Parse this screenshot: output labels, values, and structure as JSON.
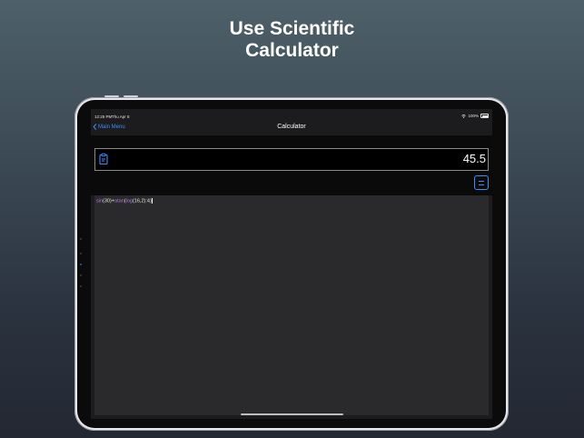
{
  "headline": {
    "line1": "Use Scientific",
    "line2": "Calculator"
  },
  "status_bar": {
    "time": "12:25 PM",
    "date": "Thu Apr 8",
    "battery": "100%"
  },
  "nav": {
    "back_label": "Main Menu",
    "title": "Calculator"
  },
  "result": {
    "value": "45.5"
  },
  "expression": {
    "parts": [
      {
        "t": "fn",
        "v": "sin"
      },
      {
        "t": "op",
        "v": "("
      },
      {
        "t": "num",
        "v": "30"
      },
      {
        "t": "op",
        "v": ")+"
      },
      {
        "t": "fn",
        "v": "atan"
      },
      {
        "t": "op",
        "v": "("
      },
      {
        "t": "fn",
        "v": "log"
      },
      {
        "t": "op",
        "v": "("
      },
      {
        "t": "num",
        "v": "16,2"
      },
      {
        "t": "op",
        "v": ")"
      },
      {
        "t": "op",
        "v": ":"
      },
      {
        "t": "num",
        "v": "4"
      },
      {
        "t": "op",
        "v": ")"
      }
    ]
  },
  "colors": {
    "accent": "#3a8eff",
    "function": "#b478e0",
    "editor_bg": "#2a2a2c"
  },
  "icons": {
    "back": "chevron-left-icon",
    "clipboard": "clipboard-icon",
    "equals": "equals-icon",
    "wifi": "wifi-icon",
    "battery": "battery-icon"
  }
}
